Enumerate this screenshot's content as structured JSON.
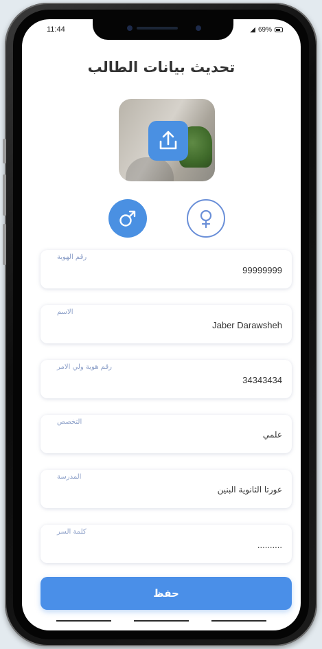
{
  "status_bar": {
    "time": "11:44",
    "battery": "69%"
  },
  "header": {
    "title": "تحديث بيانات الطالب"
  },
  "photo": {
    "upload_icon": "upload-icon"
  },
  "gender": {
    "male_icon": "male-symbol-icon",
    "female_icon": "female-symbol-icon",
    "selected": "male"
  },
  "form": {
    "fields": [
      {
        "label": "رقم الهوية",
        "value": "99999999"
      },
      {
        "label": "الاسم",
        "value": "Jaber Darawsheh"
      },
      {
        "label": "رقم هوية ولي الامر",
        "value": "34343434"
      },
      {
        "label": "التخصص",
        "value": "علمي"
      },
      {
        "label": "المدرسة",
        "value": "عورتا الثانوية البنين"
      },
      {
        "label": "كلمة السر",
        "value": ".........."
      }
    ]
  },
  "actions": {
    "save_label": "حفظ"
  },
  "colors": {
    "accent": "#4a90e2",
    "label": "#8ea1c9"
  }
}
